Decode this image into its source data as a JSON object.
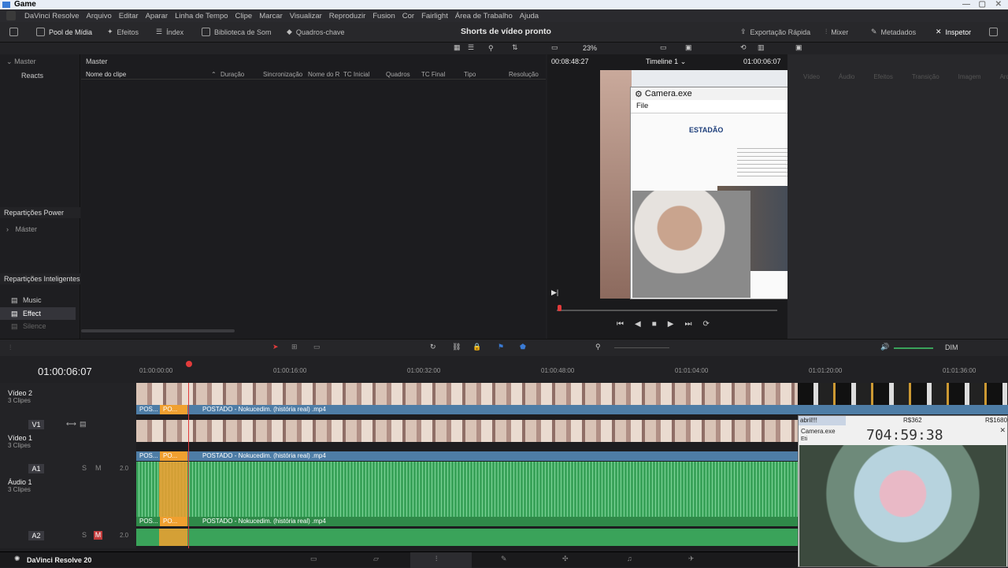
{
  "os": {
    "title": "Game"
  },
  "menu": [
    "DaVinci Resolve",
    "Arquivo",
    "Editar",
    "Aparar",
    "Linha de Tempo",
    "Clipe",
    "Marcar",
    "Visualizar",
    "Reproduzir",
    "Fusion",
    "Cor",
    "Fairlight",
    "Área de Trabalho",
    "Ajuda"
  ],
  "toolbar": {
    "left": [
      "Pool de Mídia",
      "Efeitos",
      "Índex",
      "Biblioteca de Som",
      "Quadros-chave"
    ],
    "project_title": "Shorts de vídeo pronto",
    "right": [
      "Exportação Rápida",
      "Mixer",
      "Metadados",
      "Inspetor"
    ]
  },
  "subtool": {
    "zoom": "23%",
    "timecode_left": "00:08:48:27",
    "timeline_name": "Timeline 1",
    "timecode_right": "01:00:06:07"
  },
  "bins": {
    "master_label": "Master",
    "items": [
      "Reacts"
    ],
    "power_title": "Repartições Power",
    "power_items": [
      "Máster"
    ],
    "smart_title": "Repartições Inteligentes",
    "smart_items": [
      "Music",
      "Effect",
      "Silence"
    ]
  },
  "mediapool": {
    "breadcrumb": "Master",
    "columns": [
      "Nome do clipe",
      "Duração",
      "Sincronização",
      "Nome do R",
      "TC Inicial",
      "Quadros",
      "TC Final",
      "Tipo",
      "Resolução"
    ]
  },
  "inspector_tabs": [
    "Vídeo",
    "Áudio",
    "Efeitos",
    "Transição",
    "Imagem",
    "Arquivo"
  ],
  "camera_window": {
    "title": "Camera.exe",
    "menu": "File",
    "site": "ESTADÃO"
  },
  "timeline": {
    "timecode": "01:00:06:07",
    "ruler": [
      "01:00:00:00",
      "01:00:16:00",
      "01:00:32:00",
      "01:00:48:00",
      "01:01:04:00",
      "01:01:20:00",
      "01:01:36:00"
    ],
    "tracks": [
      {
        "id": "",
        "name": "Vídeo 2",
        "clips": "3 Clipes",
        "clip_label": "POSTADO - Nokucedim. (história real) .mp4",
        "short1": "POS...",
        "short2": "PO..."
      },
      {
        "id": "V1",
        "name": "Vídeo 1",
        "clips": "3 Clipes",
        "clip_label": "POSTADO - Nokucedim. (história real) .mp4",
        "short1": "POS...",
        "short2": "PO..."
      },
      {
        "id": "A1",
        "name": "Áudio 1",
        "clips": "3 Clipes",
        "clip_label": "POSTADO - Nokucedim. (história real) .mp4",
        "short1": "POS...",
        "short2": "PO...",
        "level": "2.0"
      },
      {
        "id": "A2",
        "name": "",
        "clips": "",
        "level": "2.0"
      }
    ],
    "dim_label": "DIM"
  },
  "overlay": {
    "label": "abril!!!",
    "price1": "R$362",
    "price2": "R$1680",
    "title": "Camera.exe",
    "timer": "704:59:38",
    "menu": "Eti"
  },
  "bottom": {
    "app": "DaVinci Resolve 20"
  },
  "colors": {
    "playhead": "#e23b3b",
    "clip": "#4e7da6",
    "audio": "#3aa35a",
    "selected": "#f0a030"
  }
}
